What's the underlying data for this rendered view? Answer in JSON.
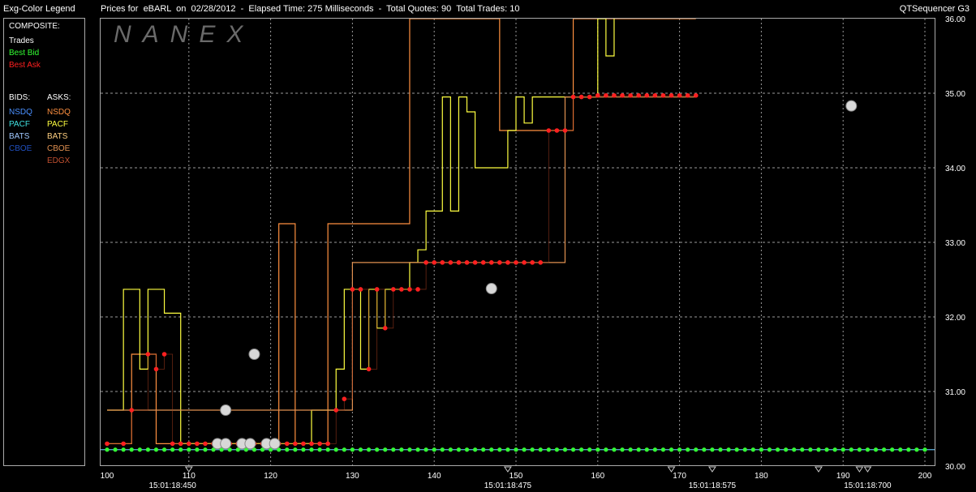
{
  "header": {
    "legend_title": "Exg-Color Legend",
    "chart_title": "Prices for  eBARL  on  02/28/2012  -  Elapsed Time: 275 Milliseconds  -  Total Quotes: 90  Total Trades: 10",
    "app_name": "QTSequencer G3"
  },
  "legend": {
    "composite_label": "COMPOSITE:",
    "trades": "Trades",
    "best_bid": "Best Bid",
    "best_ask": "Best Ask",
    "bids_label": "BIDS:",
    "asks_label": "ASKS:",
    "bids": [
      {
        "name": "NSDQ",
        "color": "#4a90ff"
      },
      {
        "name": "PACF",
        "color": "#40e0e0"
      },
      {
        "name": "BATS",
        "color": "#a0c8ff"
      },
      {
        "name": "CBOE",
        "color": "#2050c0"
      }
    ],
    "asks": [
      {
        "name": "NSDQ",
        "color": "#ff9040"
      },
      {
        "name": "PACF",
        "color": "#ffff40"
      },
      {
        "name": "BATS",
        "color": "#ffd080"
      },
      {
        "name": "CBOE",
        "color": "#e09050"
      },
      {
        "name": "EDGX",
        "color": "#c05030"
      }
    ],
    "colors": {
      "trades": "#ffffff",
      "best_bid": "#33ff33",
      "best_ask": "#ff2020"
    }
  },
  "chart_data": {
    "type": "line",
    "watermark": "NANEX",
    "xlim": [
      100,
      200
    ],
    "ylim": [
      30.0,
      36.0
    ],
    "grid": true,
    "x_ticks": [
      100,
      110,
      120,
      130,
      140,
      150,
      160,
      170,
      180,
      190,
      200
    ],
    "y_ticks": [
      "30.00",
      "31.00",
      "32.00",
      "33.00",
      "34.00",
      "35.00",
      "36.00"
    ],
    "time_labels": [
      {
        "x": 108,
        "label": "15:01:18:450"
      },
      {
        "x": 149,
        "label": "15:01:18:475"
      },
      {
        "x": 174,
        "label": "15:01:18:575"
      },
      {
        "x": 193,
        "label": "15:01:18:700"
      }
    ],
    "time_markers": [
      110,
      149,
      169,
      174,
      187,
      192,
      193
    ],
    "best_bid": {
      "price": 30.22,
      "x_start": 100,
      "x_end": 200
    },
    "best_ask": [
      {
        "x": 100,
        "y": 30.3
      },
      {
        "x": 102,
        "y": 30.3
      },
      {
        "x": 103,
        "y": 30.75
      },
      {
        "x": 105,
        "y": 31.5
      },
      {
        "x": 106,
        "y": 31.3
      },
      {
        "x": 107,
        "y": 31.5
      },
      {
        "x": 108,
        "y": 30.3
      },
      {
        "x": 109,
        "y": 30.3
      },
      {
        "x": 110,
        "y": 30.3
      },
      {
        "x": 111,
        "y": 30.3
      },
      {
        "x": 112,
        "y": 30.3
      },
      {
        "x": 113,
        "y": 30.3
      },
      {
        "x": 114,
        "y": 30.3
      },
      {
        "x": 115,
        "y": 30.3
      },
      {
        "x": 116,
        "y": 30.3
      },
      {
        "x": 117,
        "y": 30.3
      },
      {
        "x": 118,
        "y": 30.3
      },
      {
        "x": 119,
        "y": 30.3
      },
      {
        "x": 120,
        "y": 30.3
      },
      {
        "x": 121,
        "y": 30.3
      },
      {
        "x": 122,
        "y": 30.3
      },
      {
        "x": 123,
        "y": 30.3
      },
      {
        "x": 124,
        "y": 30.3
      },
      {
        "x": 125,
        "y": 30.3
      },
      {
        "x": 126,
        "y": 30.3
      },
      {
        "x": 127,
        "y": 30.3
      },
      {
        "x": 128,
        "y": 30.75
      },
      {
        "x": 129,
        "y": 30.9
      },
      {
        "x": 130,
        "y": 32.37
      },
      {
        "x": 131,
        "y": 32.37
      },
      {
        "x": 132,
        "y": 31.3
      },
      {
        "x": 133,
        "y": 32.37
      },
      {
        "x": 134,
        "y": 31.85
      },
      {
        "x": 135,
        "y": 32.37
      },
      {
        "x": 136,
        "y": 32.37
      },
      {
        "x": 137,
        "y": 32.37
      },
      {
        "x": 138,
        "y": 32.37
      },
      {
        "x": 139,
        "y": 32.73
      },
      {
        "x": 140,
        "y": 32.73
      },
      {
        "x": 141,
        "y": 32.73
      },
      {
        "x": 142,
        "y": 32.73
      },
      {
        "x": 143,
        "y": 32.73
      },
      {
        "x": 144,
        "y": 32.73
      },
      {
        "x": 145,
        "y": 32.73
      },
      {
        "x": 146,
        "y": 32.73
      },
      {
        "x": 147,
        "y": 32.73
      },
      {
        "x": 148,
        "y": 32.73
      },
      {
        "x": 149,
        "y": 32.73
      },
      {
        "x": 150,
        "y": 32.73
      },
      {
        "x": 151,
        "y": 32.73
      },
      {
        "x": 152,
        "y": 32.73
      },
      {
        "x": 153,
        "y": 32.73
      },
      {
        "x": 154,
        "y": 34.5
      },
      {
        "x": 155,
        "y": 34.5
      },
      {
        "x": 156,
        "y": 34.5
      },
      {
        "x": 157,
        "y": 34.95
      },
      {
        "x": 158,
        "y": 34.95
      },
      {
        "x": 159,
        "y": 34.95
      },
      {
        "x": 160,
        "y": 34.97
      },
      {
        "x": 161,
        "y": 34.97
      },
      {
        "x": 162,
        "y": 34.97
      },
      {
        "x": 163,
        "y": 34.97
      },
      {
        "x": 164,
        "y": 34.97
      },
      {
        "x": 165,
        "y": 34.97
      },
      {
        "x": 166,
        "y": 34.97
      },
      {
        "x": 167,
        "y": 34.97
      },
      {
        "x": 168,
        "y": 34.97
      },
      {
        "x": 169,
        "y": 34.97
      },
      {
        "x": 170,
        "y": 34.97
      },
      {
        "x": 171,
        "y": 34.97
      },
      {
        "x": 172,
        "y": 34.97
      }
    ],
    "trades": [
      {
        "x": 113.5,
        "y": 30.3
      },
      {
        "x": 114.5,
        "y": 30.75
      },
      {
        "x": 114.5,
        "y": 30.3
      },
      {
        "x": 116.5,
        "y": 30.3
      },
      {
        "x": 117.5,
        "y": 30.3
      },
      {
        "x": 118.0,
        "y": 31.5
      },
      {
        "x": 119.5,
        "y": 30.3
      },
      {
        "x": 120.5,
        "y": 30.3
      },
      {
        "x": 147.0,
        "y": 32.38
      },
      {
        "x": 191.0,
        "y": 34.83
      }
    ],
    "quote_series": [
      {
        "exchange": "NSDQ",
        "side": "ask",
        "color": "#ff9040",
        "steps": [
          [
            100,
            30.3
          ],
          [
            103,
            31.5
          ],
          [
            106,
            30.3
          ],
          [
            121,
            33.25
          ],
          [
            123,
            30.3
          ],
          [
            127,
            33.25
          ],
          [
            136,
            33.25
          ],
          [
            137,
            36.0
          ],
          [
            147,
            36.0
          ],
          [
            148,
            34.5
          ],
          [
            156,
            34.5
          ],
          [
            157,
            36.0
          ],
          [
            172,
            36.0
          ]
        ]
      },
      {
        "exchange": "PACF",
        "side": "ask",
        "color": "#ffff40",
        "steps": [
          [
            100,
            30.75
          ],
          [
            102,
            32.37
          ],
          [
            104,
            31.3
          ],
          [
            105,
            32.37
          ],
          [
            107,
            32.05
          ],
          [
            109,
            30.3
          ],
          [
            125,
            30.75
          ],
          [
            126,
            30.75
          ],
          [
            127,
            30.75
          ],
          [
            128,
            31.3
          ],
          [
            129,
            32.37
          ],
          [
            131,
            31.3
          ],
          [
            132,
            32.37
          ],
          [
            133,
            31.85
          ],
          [
            134,
            32.37
          ],
          [
            137,
            32.73
          ],
          [
            138,
            32.9
          ],
          [
            139,
            33.42
          ],
          [
            141,
            34.95
          ],
          [
            142,
            33.42
          ],
          [
            143,
            34.95
          ],
          [
            144,
            34.75
          ],
          [
            145,
            34.0
          ],
          [
            149,
            34.5
          ],
          [
            150,
            34.95
          ],
          [
            151,
            34.6
          ],
          [
            152,
            34.95
          ],
          [
            159,
            34.95
          ],
          [
            160,
            36.0
          ],
          [
            161,
            35.5
          ],
          [
            162,
            36.0
          ]
        ]
      },
      {
        "exchange": "CBOE",
        "side": "ask",
        "color": "#e09050",
        "steps": [
          [
            100,
            30.75
          ],
          [
            129,
            30.75
          ],
          [
            130,
            32.73
          ],
          [
            155,
            32.73
          ],
          [
            156,
            34.95
          ],
          [
            172,
            34.95
          ]
        ]
      }
    ]
  }
}
